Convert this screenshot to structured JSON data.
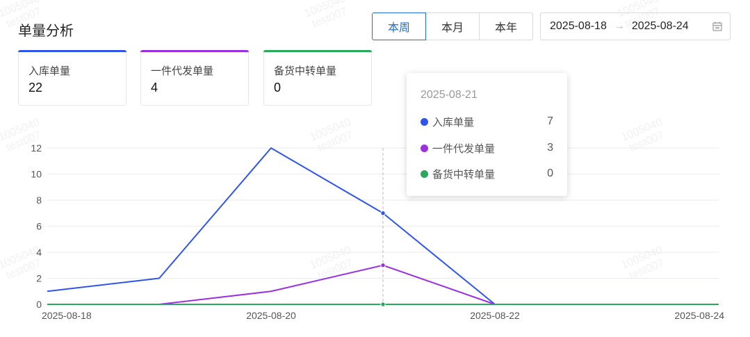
{
  "header": {
    "title": "单量分析"
  },
  "period_tabs": [
    {
      "label": "本周",
      "active": true
    },
    {
      "label": "本月",
      "active": false
    },
    {
      "label": "本年",
      "active": false
    }
  ],
  "date_range": {
    "start": "2025-08-18",
    "end": "2025-08-24",
    "separator": "→",
    "icon": "calendar-icon"
  },
  "watermark": {
    "line1": "1005040",
    "line2": "test007"
  },
  "cards": [
    {
      "label": "入库单量",
      "value": "22",
      "color": "#2f54eb"
    },
    {
      "label": "一件代发单量",
      "value": "4",
      "color": "#9b30e0"
    },
    {
      "label": "备货中转单量",
      "value": "0",
      "color": "#27a85a"
    }
  ],
  "tooltip": {
    "date": "2025-08-21",
    "rows": [
      {
        "label": "入库单量",
        "value": "7",
        "color": "#2f54eb"
      },
      {
        "label": "一件代发单量",
        "value": "3",
        "color": "#9b30e0"
      },
      {
        "label": "备货中转单量",
        "value": "0",
        "color": "#27a85a"
      }
    ]
  },
  "chart_data": {
    "type": "line",
    "x": [
      "2025-08-18",
      "2025-08-19",
      "2025-08-20",
      "2025-08-21",
      "2025-08-22",
      "2025-08-23",
      "2025-08-24"
    ],
    "x_tick_labels": [
      "2025-08-18",
      "2025-08-20",
      "2025-08-22",
      "2025-08-24"
    ],
    "y_ticks": [
      0,
      2,
      4,
      6,
      8,
      10,
      12
    ],
    "ylim": [
      0,
      12
    ],
    "grid": true,
    "highlight_x": "2025-08-21",
    "series": [
      {
        "name": "入库单量",
        "color": "#2f54eb",
        "values": [
          1,
          2,
          12,
          7,
          0,
          0,
          0
        ]
      },
      {
        "name": "一件代发单量",
        "color": "#9b30e0",
        "values": [
          0,
          0,
          1,
          3,
          0,
          0,
          0
        ]
      },
      {
        "name": "备货中转单量",
        "color": "#27a85a",
        "values": [
          0,
          0,
          0,
          0,
          0,
          0,
          0
        ]
      }
    ]
  }
}
